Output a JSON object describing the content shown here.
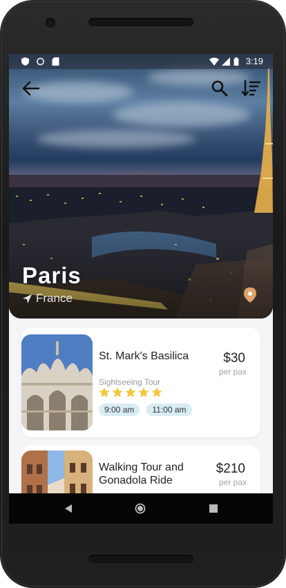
{
  "status_bar": {
    "time": "3:19"
  },
  "hero": {
    "city": "Paris",
    "country": "France"
  },
  "tours": [
    {
      "name": "St. Mark's Basilica",
      "type": "Sightseeing Tour",
      "rating": 5,
      "times": [
        "9:00 am",
        "11:00 am"
      ],
      "price": "$30",
      "price_unit": "per pax"
    },
    {
      "name": "Walking Tour and Gonadola Ride",
      "price": "$210",
      "price_unit": "per pax"
    }
  ],
  "colors": {
    "chip_bg": "#d8ecf3",
    "star": "#f3c73c",
    "card_bg": "#ffffff",
    "screen_bg": "#f4f5f7"
  }
}
